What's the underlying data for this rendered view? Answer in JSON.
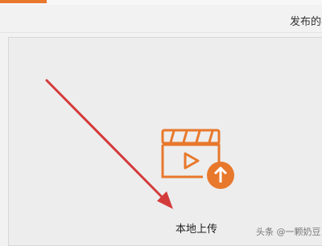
{
  "header": {
    "right_text": "发布的视"
  },
  "upload": {
    "label": "本地上传",
    "icon": "video-upload-icon"
  },
  "watermark": {
    "text": "头条 @一颗奶豆"
  },
  "colors": {
    "accent": "#e8782c",
    "arrow": "#d43b3b"
  }
}
